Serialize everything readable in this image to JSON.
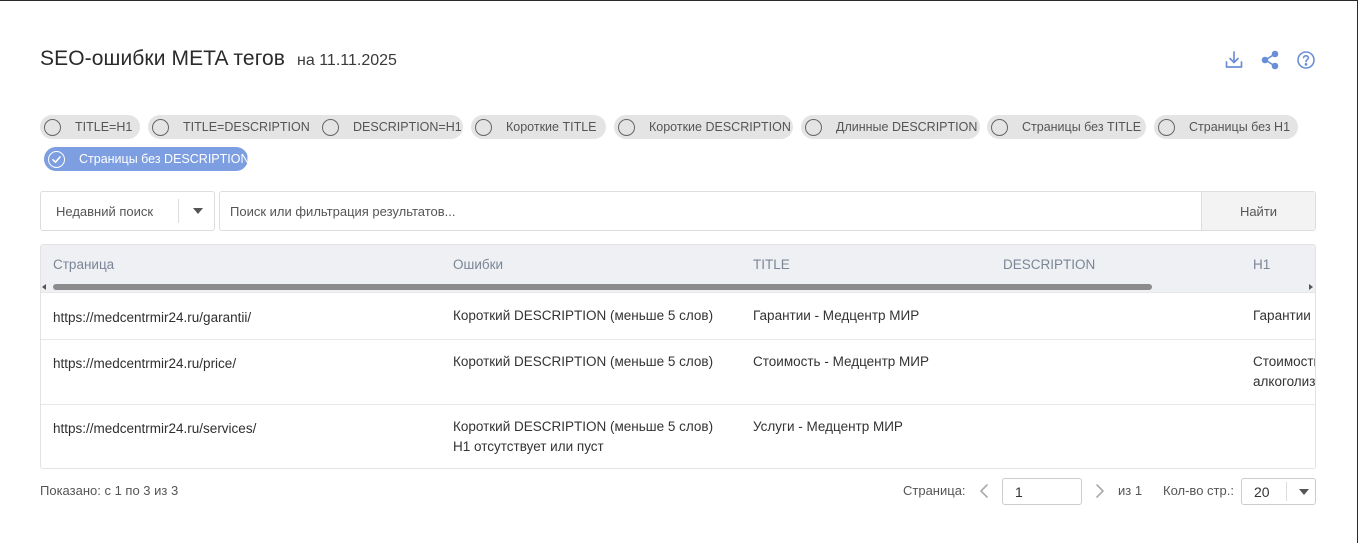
{
  "header": {
    "title": "SEO-ошибки META тегов",
    "date": "на 11.11.2025",
    "accent_color": "#6b8fd6"
  },
  "toolbar": {
    "icons": [
      "download-icon",
      "share-icon",
      "help-icon"
    ]
  },
  "filters": [
    {
      "label": "TITLE=H1",
      "selected": false
    },
    {
      "label": "TITLE=DESCRIPTION",
      "selected": false
    },
    {
      "label": "DESCRIPTION=H1",
      "selected": false
    },
    {
      "label": "Короткие TITLE",
      "selected": false
    },
    {
      "label": "Короткие DESCRIPTION",
      "selected": false
    },
    {
      "label": "Длинные DESCRIPTION",
      "selected": false
    },
    {
      "label": "Страницы без TITLE",
      "selected": false
    },
    {
      "label": "Страницы без H1",
      "selected": false
    },
    {
      "label": "Страницы без DESCRIPTION",
      "selected": true
    }
  ],
  "search": {
    "recent_label": "Недавний поиск",
    "placeholder": "Поиск или фильтрация результатов...",
    "value": "",
    "button_label": "Найти"
  },
  "table": {
    "columns": [
      "Страница",
      "Ошибки",
      "TITLE",
      "DESCRIPTION",
      "H1"
    ],
    "rows": [
      {
        "page": "https://medcentrmir24.ru/garantii/",
        "errors": [
          "Короткий DESCRIPTION (меньше 5 слов)"
        ],
        "title": "Гарантии - Медцентр МИР",
        "description": "",
        "h1": [
          "Гарантии"
        ]
      },
      {
        "page": "https://medcentrmir24.ru/price/",
        "errors": [
          "Короткий DESCRIPTION (меньше 5 слов)"
        ],
        "title": "Стоимость - Медцентр МИР",
        "description": "",
        "h1": [
          "Стоимость",
          "алкоголиз"
        ]
      },
      {
        "page": "https://medcentrmir24.ru/services/",
        "errors": [
          "Короткий DESCRIPTION (меньше 5 слов)",
          "H1 отсутствует или пуст"
        ],
        "title": "Услуги - Медцентр МИР",
        "description": "",
        "h1": []
      }
    ]
  },
  "footer": {
    "shown": "Показано: с 1 по 3 из 3",
    "page_label": "Страница:",
    "page_value": "1",
    "of_total": "из 1",
    "per_page_label": "Кол-во стр.:",
    "per_page_value": "20"
  }
}
